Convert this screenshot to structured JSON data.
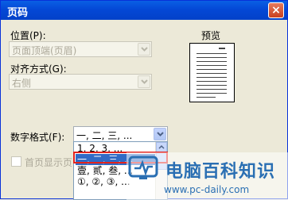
{
  "window": {
    "title": "页码",
    "close_glyph": "×"
  },
  "position": {
    "label": "位置(P):",
    "value": "页面顶端(页眉)"
  },
  "alignment": {
    "label": "对齐方式(G):",
    "value": "右侧"
  },
  "preview": {
    "label": "预览"
  },
  "number_format": {
    "label": "数字格式(F):",
    "selected": "一, 二, 三, ...",
    "options": [
      "1, 2, 3, ...",
      "一, 二, 三, ...",
      "壹, 贰, 叁, ...",
      "①, ②, ③, ..."
    ]
  },
  "first_page": {
    "label": "首页显示页"
  },
  "watermark": {
    "site_name": "电脑百科知识",
    "url": "www.pc-daily.com"
  },
  "colors": {
    "title_bar": "#0448d6",
    "selected_item": "#316ac5",
    "highlight_border": "#e3231d",
    "watermark_text": "#2a6fb3"
  }
}
